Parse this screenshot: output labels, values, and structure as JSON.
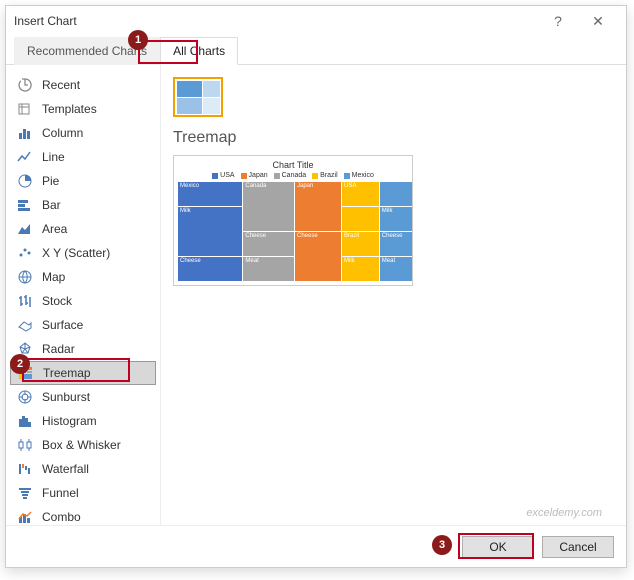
{
  "window": {
    "title": "Insert Chart",
    "help": "?",
    "close": "✕"
  },
  "tabs": {
    "recommended": "Recommended Charts",
    "all": "All Charts"
  },
  "sidebar": {
    "items": [
      {
        "label": "Recent"
      },
      {
        "label": "Templates"
      },
      {
        "label": "Column"
      },
      {
        "label": "Line"
      },
      {
        "label": "Pie"
      },
      {
        "label": "Bar"
      },
      {
        "label": "Area"
      },
      {
        "label": "X Y (Scatter)"
      },
      {
        "label": "Map"
      },
      {
        "label": "Stock"
      },
      {
        "label": "Surface"
      },
      {
        "label": "Radar"
      },
      {
        "label": "Treemap"
      },
      {
        "label": "Sunburst"
      },
      {
        "label": "Histogram"
      },
      {
        "label": "Box & Whisker"
      },
      {
        "label": "Waterfall"
      },
      {
        "label": "Funnel"
      },
      {
        "label": "Combo"
      }
    ]
  },
  "content": {
    "subtype_name": "Treemap",
    "preview": {
      "title": "Chart Title",
      "legend": [
        {
          "label": "USA",
          "color": "#4472c4"
        },
        {
          "label": "Japan",
          "color": "#ed7d31"
        },
        {
          "label": "Canada",
          "color": "#a5a5a5"
        },
        {
          "label": "Brazil",
          "color": "#ffc000"
        },
        {
          "label": "Mexico",
          "color": "#5b9bd5"
        }
      ],
      "cells": [
        {
          "label": "Mexico",
          "cls": "c-usa",
          "col": "1",
          "row": "1"
        },
        {
          "label": "Canada",
          "cls": "c-can",
          "col": "2",
          "row": "1/3"
        },
        {
          "label": "Japan",
          "cls": "c-jpn",
          "col": "3",
          "row": "1/3"
        },
        {
          "label": "USA",
          "cls": "c-brz",
          "col": "4",
          "row": "1"
        },
        {
          "label": "",
          "cls": "c-mex",
          "col": "5",
          "row": "1"
        },
        {
          "label": "Milk",
          "cls": "c-usa",
          "col": "1",
          "row": "2/4"
        },
        {
          "label": "",
          "cls": "c-brz",
          "col": "4",
          "row": "2"
        },
        {
          "label": "Milk",
          "cls": "c-mex",
          "col": "5",
          "row": "2"
        },
        {
          "label": "Cheese",
          "cls": "c-jpn",
          "col": "3",
          "row": "3/5"
        },
        {
          "label": "Brazil",
          "cls": "c-brz",
          "col": "4",
          "row": "3"
        },
        {
          "label": "Cheese",
          "cls": "c-mex",
          "col": "5",
          "row": "3"
        },
        {
          "label": "Cheese",
          "cls": "c-usa",
          "col": "1",
          "row": "4"
        },
        {
          "label": "Cheese",
          "cls": "c-can",
          "col": "2",
          "row": "3"
        },
        {
          "label": "Meat",
          "cls": "c-can",
          "col": "2",
          "row": "4"
        },
        {
          "label": "Meat",
          "cls": "c-jpn",
          "col": "3",
          "row": "4",
          "hidden": "1"
        },
        {
          "label": "Milk",
          "cls": "c-brz",
          "col": "4",
          "row": "4"
        },
        {
          "label": "Meat",
          "cls": "c-mex",
          "col": "5",
          "row": "4"
        },
        {
          "label": "Meat",
          "cls": "c-usa",
          "col": "1",
          "row": "4",
          "hidden": "1"
        }
      ]
    }
  },
  "footer": {
    "ok": "OK",
    "cancel": "Cancel"
  },
  "watermark": "exceldemy.com",
  "markers": {
    "m1": "1",
    "m2": "2",
    "m3": "3"
  }
}
